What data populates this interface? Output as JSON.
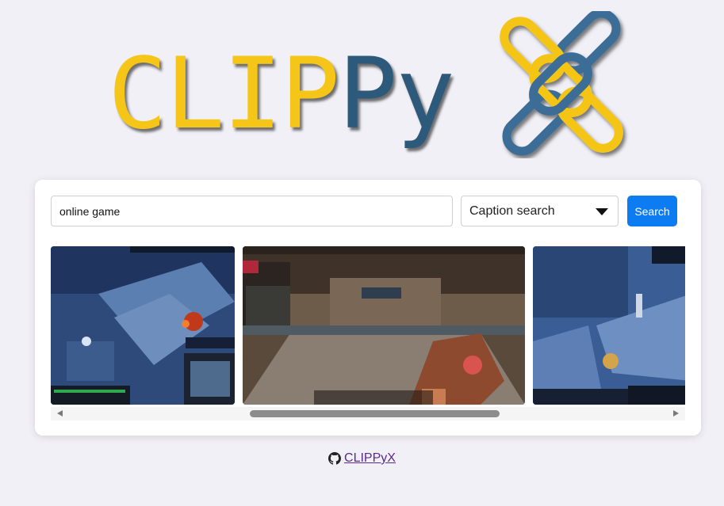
{
  "logo": {
    "part_clip": "CLIP",
    "part_py": "Py",
    "icon": "chain-x-logo",
    "colors": {
      "clip": "#f5c518",
      "py": "#2d5a7b",
      "x_yellow": "#f5c518",
      "x_blue": "#3b6d96"
    }
  },
  "search": {
    "value": "online game",
    "mode_selected": "Caption search",
    "button_label": "Search"
  },
  "results": [
    {
      "kind": "moba-screenshot",
      "icon": "video-thumbnail"
    },
    {
      "kind": "fps-screenshot",
      "icon": "video-thumbnail"
    },
    {
      "kind": "moba-screenshot",
      "icon": "video-thumbnail"
    }
  ],
  "scrollbar": {
    "position_fraction": 0.34
  },
  "footer": {
    "icon": "github-icon",
    "link_text": "CLIPPyX"
  },
  "colors": {
    "background": "#f1f0f6",
    "accent": "#0d7cf2",
    "link": "#5a2b8c"
  }
}
